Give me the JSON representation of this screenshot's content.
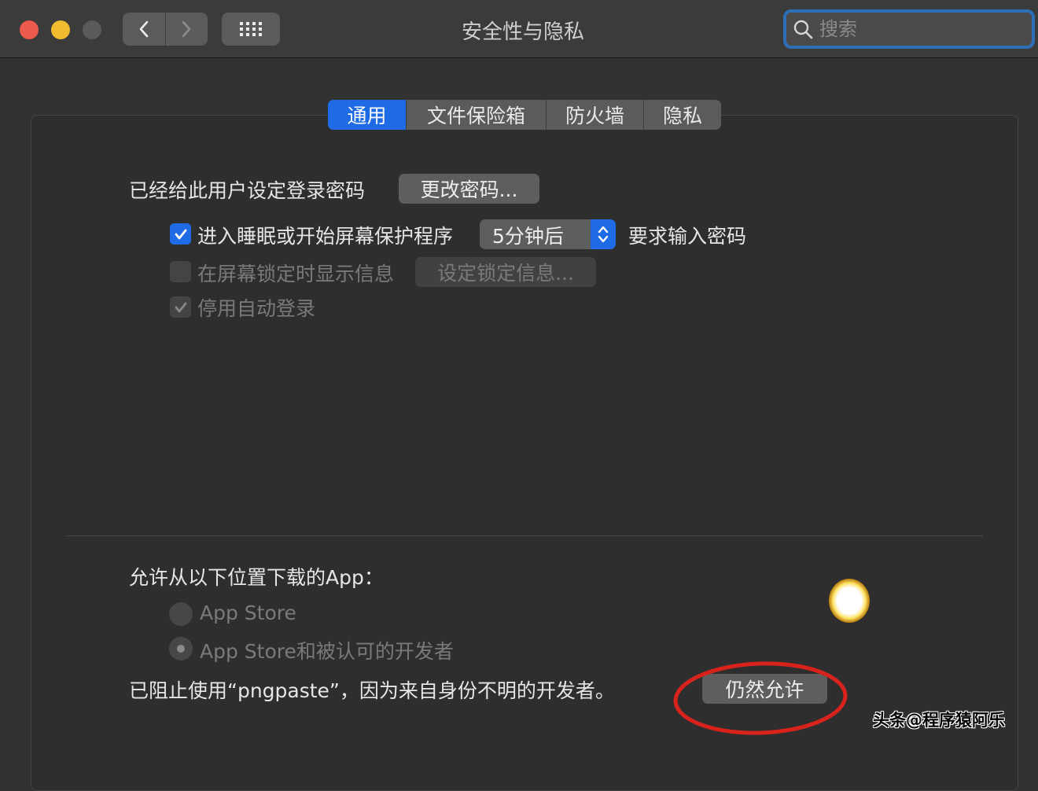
{
  "window": {
    "title": "安全性与隐私"
  },
  "search": {
    "placeholder": "搜索"
  },
  "tabs": [
    {
      "label": "通用",
      "active": true
    },
    {
      "label": "文件保险箱",
      "active": false
    },
    {
      "label": "防火墙",
      "active": false
    },
    {
      "label": "隐私",
      "active": false
    }
  ],
  "general": {
    "password_set_label": "已经给此用户设定登录密码",
    "change_password_button": "更改密码...",
    "require_password": {
      "checked": true,
      "label": "进入睡眠或开始屏幕保护程序",
      "delay_selected": "5分钟后",
      "suffix": "要求输入密码"
    },
    "show_message": {
      "checked": false,
      "label": "在屏幕锁定时显示信息",
      "button": "设定锁定信息..."
    },
    "disable_autologin": {
      "checked": true,
      "label": "停用自动登录"
    }
  },
  "downloads": {
    "heading": "允许从以下位置下载的App：",
    "options": [
      {
        "label": "App Store",
        "selected": false
      },
      {
        "label": "App Store和被认可的开发者",
        "selected": true
      }
    ],
    "blocked_message": "已阻止使用“pngpaste”，因为来自身份不明的开发者。",
    "allow_anyway_button": "仍然允许"
  },
  "watermark": "头条@程序猿阿乐",
  "colors": {
    "accent": "#1e6be5",
    "annotation": "#d8231c"
  }
}
